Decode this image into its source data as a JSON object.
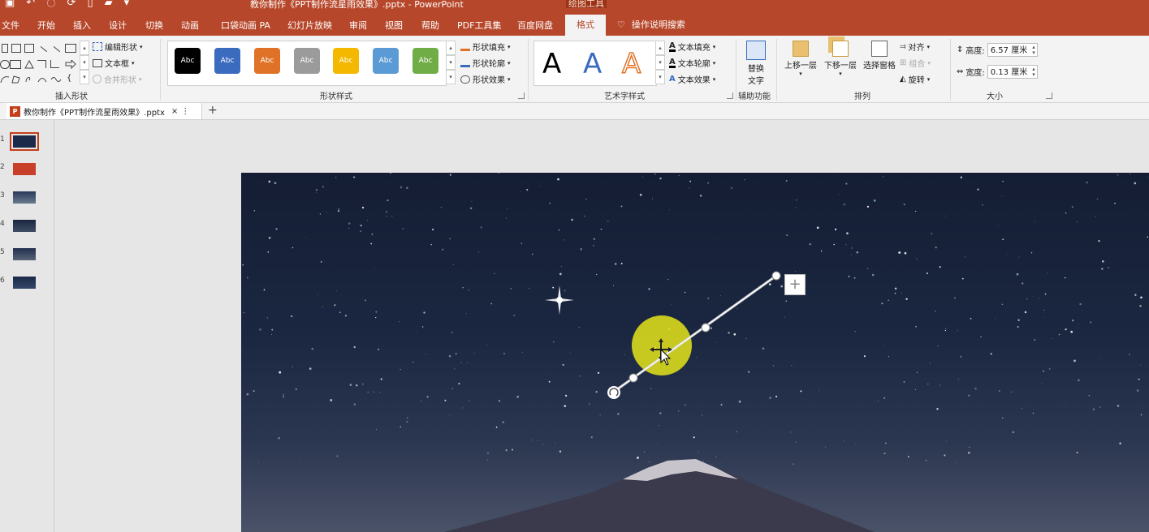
{
  "window": {
    "document_title": "教你制作《PPT制作流星雨效果》.pptx - PowerPoint",
    "context_group": "绘图工具"
  },
  "quick_access": {
    "icons": [
      "save-icon",
      "undo-icon",
      "redo-icon",
      "refresh-icon",
      "new-file-icon",
      "open-folder-icon",
      "customize-icon"
    ]
  },
  "tabs": [
    {
      "label": "文件"
    },
    {
      "label": "开始"
    },
    {
      "label": "插入"
    },
    {
      "label": "设计"
    },
    {
      "label": "切换"
    },
    {
      "label": "动画"
    },
    {
      "label": "口袋动画 PA"
    },
    {
      "label": "幻灯片放映"
    },
    {
      "label": "审阅"
    },
    {
      "label": "视图"
    },
    {
      "label": "帮助"
    },
    {
      "label": "PDF工具集"
    },
    {
      "label": "百度网盘"
    },
    {
      "label": "格式"
    }
  ],
  "tell_me": "操作说明搜索",
  "ribbon": {
    "insert_shapes": {
      "label": "插入形状",
      "edit_shape": "编辑形状",
      "text_box": "文本框",
      "merge_shapes": "合并形状"
    },
    "shape_styles": {
      "label": "形状样式",
      "swatches": [
        {
          "text": "Abc",
          "color": "#000000"
        },
        {
          "text": "Abc",
          "color": "#3a6bbf"
        },
        {
          "text": "Abc",
          "color": "#e07228"
        },
        {
          "text": "Abc",
          "color": "#9b9b9b"
        },
        {
          "text": "Abc",
          "color": "#f4b800"
        },
        {
          "text": "Abc",
          "color": "#5b9bd5"
        },
        {
          "text": "Abc",
          "color": "#70ad47"
        }
      ],
      "fill": "形状填充",
      "outline": "形状轮廓",
      "effects": "形状效果"
    },
    "wordart": {
      "label": "艺术字样式",
      "samples": [
        "A",
        "A",
        "A"
      ],
      "text_fill": "文本填充",
      "text_outline": "文本轮廓",
      "text_effects": "文本效果"
    },
    "accessibility": {
      "label": "辅助功能",
      "alt_text_line1": "替换",
      "alt_text_line2": "文字"
    },
    "arrange": {
      "label": "排列",
      "bring_forward": "上移一层",
      "send_backward": "下移一层",
      "selection_pane": "选择窗格",
      "align": "对齐",
      "group": "组合",
      "rotate": "旋转"
    },
    "size": {
      "label": "大小",
      "height_label": "高度:",
      "height_value": "6.57 厘米",
      "width_label": "宽度:",
      "width_value": "0.13 厘米"
    }
  },
  "doc_tab": {
    "badge": "P",
    "filename": "教你制作《PPT制作流星雨效果》.pptx",
    "close": "×",
    "more": "⋮",
    "add": "+"
  },
  "thumbnails": [
    {
      "num": "1",
      "selected": true
    },
    {
      "num": "2",
      "selected": false
    },
    {
      "num": "3",
      "selected": false
    },
    {
      "num": "4",
      "selected": false
    },
    {
      "num": "5",
      "selected": false
    },
    {
      "num": "6",
      "selected": false
    }
  ],
  "slide": {
    "add_button": "+",
    "colors": {
      "sky": "#1b2741",
      "highlight": "#e5e51a",
      "accent": "#b7472a"
    }
  }
}
